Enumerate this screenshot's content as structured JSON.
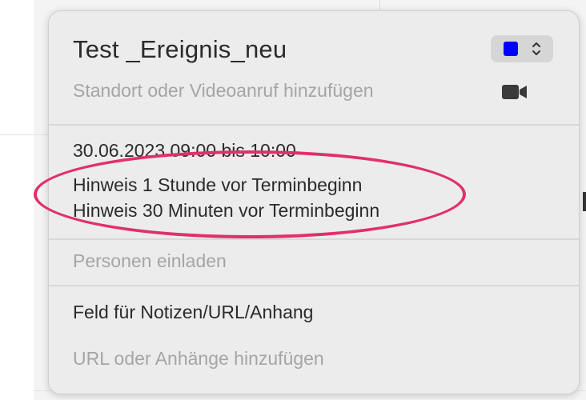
{
  "event": {
    "title": "Test _Ereignis_neu",
    "location_placeholder": "Standort oder Videoanruf hinzufügen",
    "calendar_color": "#0000ff",
    "date_time": "30.06.2023  09:00 bis 10:00",
    "alerts": [
      "Hinweis 1 Stunde vor Terminbeginn",
      "Hinweis 30 Minuten vor Terminbeginn"
    ],
    "invitees_placeholder": "Personen einladen",
    "notes_text": "Feld für Notizen/URL/Anhang",
    "url_placeholder": "URL oder Anhänge hinzufügen"
  },
  "icons": {
    "calendar_picker": "chevron-up-down-icon",
    "video": "video-camera-icon"
  },
  "annotation": {
    "color": "#e0306a"
  }
}
